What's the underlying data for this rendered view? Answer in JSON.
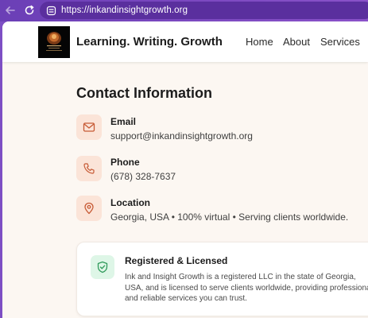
{
  "browser": {
    "url": "https://inkandinsightgrowth.org",
    "back_icon": "arrow-left-icon",
    "reload_icon": "reload-icon",
    "lock_icon": "site-info-icon"
  },
  "header": {
    "brand": "Learning. Writing. Growth",
    "nav": {
      "home": "Home",
      "about": "About",
      "services": "Services"
    }
  },
  "contact": {
    "title": "Contact Information",
    "email": {
      "icon": "mail-icon",
      "label": "Email",
      "value": "support@inkandinsightgrowth.org"
    },
    "phone": {
      "icon": "phone-icon",
      "label": "Phone",
      "value": "(678) 328-7637"
    },
    "location": {
      "icon": "map-pin-icon",
      "label": "Location",
      "value": "Georgia, USA • 100% virtual • Serving clients worldwide."
    }
  },
  "license": {
    "icon": "shield-check-icon",
    "title": "Registered & Licensed",
    "text": "Ink and Insight Growth is a registered LLC in the state of Georgia, USA, and is licensed to serve clients worldwide, providing professional and reliable services you can trust."
  },
  "colors": {
    "browser_accent": "#7d4fc4",
    "icon_bg": "#fbe4d8",
    "icon_stroke": "#c75a35",
    "license_icon_bg": "#def6e7",
    "license_icon_stroke": "#2f9a5a",
    "page_bg": "#fcf7f2"
  }
}
